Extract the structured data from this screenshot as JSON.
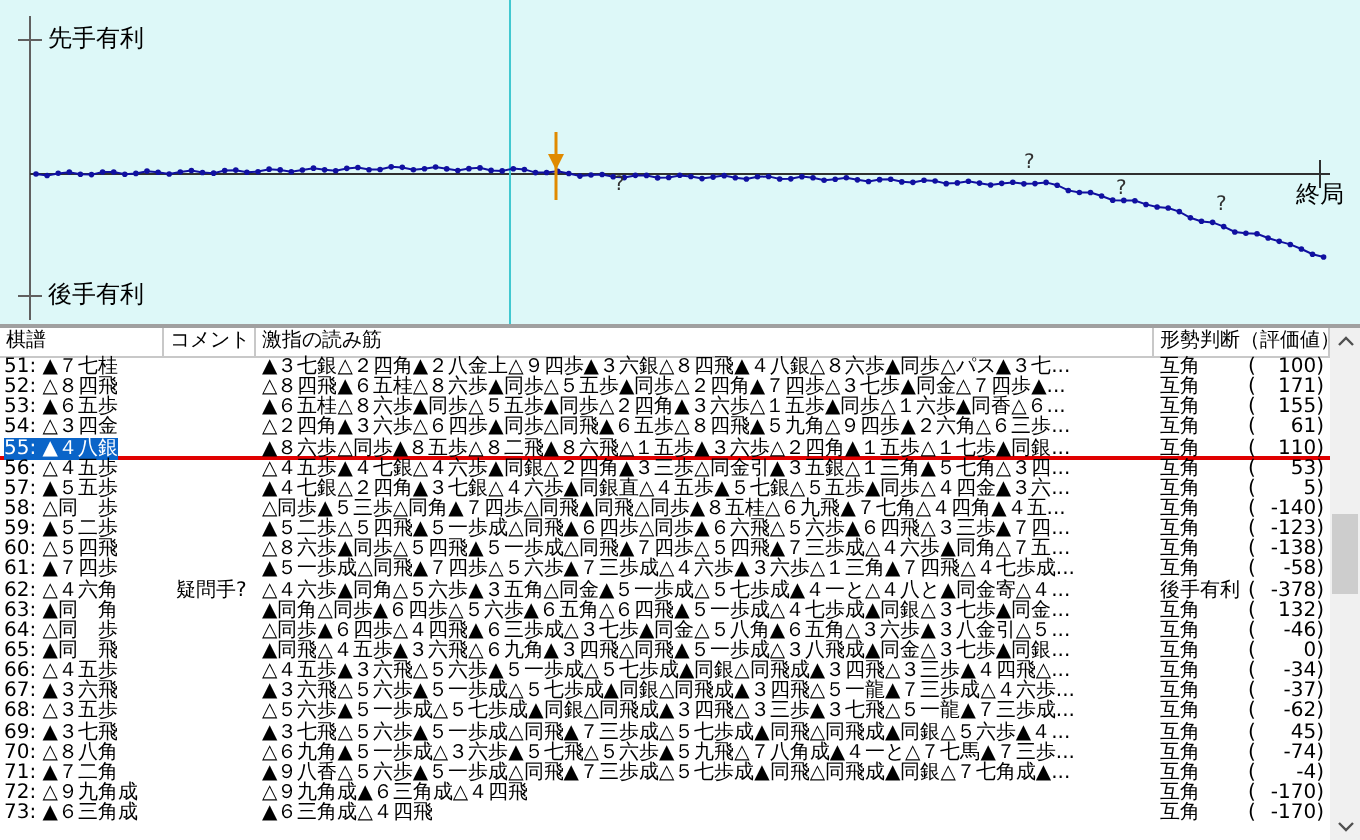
{
  "chart": {
    "top_label": "先手有利",
    "bottom_label": "後手有利",
    "end_label": "終局",
    "question_marks": [
      "?",
      "?",
      "?",
      "?"
    ]
  },
  "table": {
    "columns": [
      "棋譜",
      "コメント",
      "激指の読み筋",
      "形勢判断（評価値）"
    ],
    "rows": [
      {
        "move": "51: ▲７七桂",
        "line": "▲３七銀△２四角▲２八金上△９四歩▲３六銀△８四飛▲４八銀△８六歩▲同歩△パス▲３七...",
        "judgement": "互角",
        "paren": "(",
        "score": "100)",
        "selected": false
      },
      {
        "move": "52: △８四飛",
        "line": "△８四飛▲６五桂△８六歩▲同歩△５五歩▲同歩△２四角▲７四歩△３七歩▲同金△７四歩▲...",
        "judgement": "互角",
        "paren": "(",
        "score": "171)",
        "selected": false
      },
      {
        "move": "53: ▲６五歩",
        "line": "▲６五桂△８六歩▲同歩△５五歩▲同歩△２四角▲３六歩△１五歩▲同歩△１六歩▲同香△６...",
        "judgement": "互角",
        "paren": "(",
        "score": "155)",
        "selected": false
      },
      {
        "move": "54: △３四金",
        "line": "△２四角▲３六歩△６四歩▲同歩△同飛▲６五歩△８四飛▲５九角△９四歩▲２六角△６三歩...",
        "judgement": "互角",
        "paren": "(",
        "score": "61)",
        "selected": false
      },
      {
        "move": "55: ▲４八銀",
        "line": "▲８六歩△同歩▲８五歩△８二飛▲８六飛△１五歩▲３六歩△２四角▲１五歩△１七歩▲同銀...",
        "judgement": "互角",
        "paren": "(",
        "score": "110)",
        "selected": true
      },
      {
        "move": "56: △４五歩",
        "line": "△４五歩▲４七銀△４六歩▲同銀△２四角▲３三歩△同金引▲３五銀△１三角▲５七角△３四...",
        "judgement": "互角",
        "paren": "(",
        "score": "53)",
        "selected": false
      },
      {
        "move": "57: ▲５五歩",
        "line": "▲４七銀△２四角▲３七銀△４六歩▲同銀直△４五歩▲５七銀△５五歩▲同歩△４四金▲３六...",
        "judgement": "互角",
        "paren": "(",
        "score": "5)",
        "selected": false
      },
      {
        "move": "58: △同　歩",
        "line": "△同歩▲５三歩△同角▲７四歩△同飛▲同飛△同歩▲８五桂△６九飛▲７七角△４四角▲４五...",
        "judgement": "互角",
        "paren": "(",
        "score": "-140)",
        "selected": false
      },
      {
        "move": "59: ▲５二歩",
        "line": "▲５二歩△５四飛▲５一歩成△同飛▲６四歩△同歩▲６六飛△５六歩▲６四飛△３三歩▲７四...",
        "judgement": "互角",
        "paren": "(",
        "score": "-123)",
        "selected": false
      },
      {
        "move": "60: △５四飛",
        "line": "△８六歩▲同歩△５四飛▲５一歩成△同飛▲７四歩△５四飛▲７三歩成△４六歩▲同角△７五...",
        "judgement": "互角",
        "paren": "(",
        "score": "-138)",
        "selected": false
      },
      {
        "move": "61: ▲７四歩",
        "line": "▲５一歩成△同飛▲７四歩△５六歩▲７三歩成△４六歩▲３六歩△１三角▲７四飛△４七歩成...",
        "judgement": "互角",
        "paren": "(",
        "score": "-58)",
        "selected": false
      },
      {
        "move": "62: △４六角",
        "comment": "疑問手?",
        "line": "△４六歩▲同角△５六歩▲３五角△同金▲５一歩成△５七歩成▲４一と△４八と▲同金寄△４...",
        "judgement": "後手有利",
        "paren": "(",
        "score": "-378)",
        "selected": false
      },
      {
        "move": "63: ▲同　角",
        "line": "▲同角△同歩▲６四歩△５六歩▲６五角△６四飛▲５一歩成△４七歩成▲同銀△３七歩▲同金...",
        "judgement": "互角",
        "paren": "(",
        "score": "132)",
        "selected": false
      },
      {
        "move": "64: △同　歩",
        "line": "△同歩▲６四歩△４四飛▲６三歩成△３七歩▲同金△５八角▲６五角△３六歩▲３八金引△５...",
        "judgement": "互角",
        "paren": "(",
        "score": "-46)",
        "selected": false
      },
      {
        "move": "65: ▲同　飛",
        "line": "▲同飛△４五歩▲３六飛△６九角▲３四飛△同飛▲５一歩成△３八飛成▲同金△３七歩▲同銀...",
        "judgement": "互角",
        "paren": "(",
        "score": "0)",
        "selected": false
      },
      {
        "move": "66: △４五歩",
        "line": "△４五歩▲３六飛△５六歩▲５一歩成△５七歩成▲同銀△同飛成▲３四飛△３三歩▲４四飛△...",
        "judgement": "互角",
        "paren": "(",
        "score": "-34)",
        "selected": false
      },
      {
        "move": "67: ▲３六飛",
        "line": "▲３六飛△５六歩▲５一歩成△５七歩成▲同銀△同飛成▲３四飛△５一龍▲７三歩成△４六歩...",
        "judgement": "互角",
        "paren": "(",
        "score": "-37)",
        "selected": false
      },
      {
        "move": "68: △３五歩",
        "line": "△５六歩▲５一歩成△５七歩成▲同銀△同飛成▲３四飛△３三歩▲３七飛△５一龍▲７三歩成...",
        "judgement": "互角",
        "paren": "(",
        "score": "-62)",
        "selected": false
      },
      {
        "move": "69: ▲３七飛",
        "line": "▲３七飛△５六歩▲５一歩成△同飛▲７三歩成△５七歩成▲同飛△同飛成▲同銀△５六歩▲４...",
        "judgement": "互角",
        "paren": "(",
        "score": "45)",
        "selected": false
      },
      {
        "move": "70: △８八角",
        "line": "△６九角▲５一歩成△３六歩▲５七飛△５六歩▲５九飛△７八角成▲４一と△７七馬▲７三歩...",
        "judgement": "互角",
        "paren": "(",
        "score": "-74)",
        "selected": false
      },
      {
        "move": "71: ▲７二角",
        "line": "▲９八香△５六歩▲５一歩成△同飛▲７三歩成△５七歩成▲同飛△同飛成▲同銀△７七角成▲...",
        "judgement": "互角",
        "paren": "(",
        "score": "-4)",
        "selected": false
      },
      {
        "move": "72: △９九角成",
        "line": "△９九角成▲６三角成△４四飛",
        "judgement": "互角",
        "paren": "(",
        "score": "-170)",
        "selected": false
      },
      {
        "move": "73: ▲６三角成",
        "line": "▲６三角成△４四飛",
        "judgement": "互角",
        "paren": "(",
        "score": "-170)",
        "selected": false
      }
    ]
  }
}
